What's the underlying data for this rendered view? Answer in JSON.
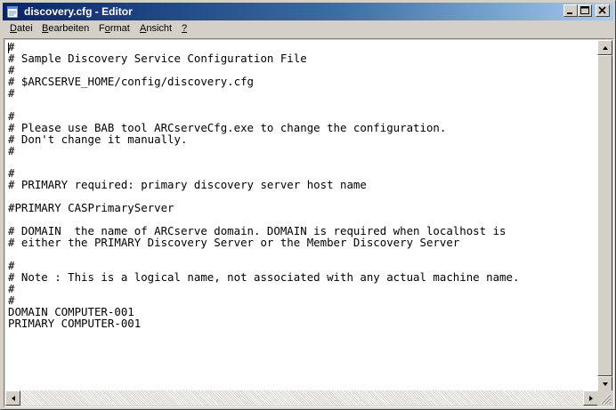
{
  "window": {
    "title": "discovery.cfg - Editor",
    "icon": "notepad-icon"
  },
  "titlebar_buttons": {
    "minimize_icon": "minimize-icon",
    "maximize_icon": "maximize-icon",
    "close_icon": "close-icon"
  },
  "menu": {
    "items": [
      {
        "label": "Datei",
        "mnemonic": "D"
      },
      {
        "label": "Bearbeiten",
        "mnemonic": "B"
      },
      {
        "label": "Format",
        "mnemonic": "o"
      },
      {
        "label": "Ansicht",
        "mnemonic": "A"
      },
      {
        "label": "?",
        "mnemonic": "?"
      }
    ]
  },
  "editor": {
    "lines": [
      "#",
      "# Sample Discovery Service Configuration File",
      "#",
      "# $ARCSERVE_HOME/config/discovery.cfg",
      "#",
      "",
      "#",
      "# Please use BAB tool ARCserveCfg.exe to change the configuration.",
      "# Don't change it manually.",
      "#",
      "",
      "#",
      "# PRIMARY required: primary discovery server host name",
      "",
      "#PRIMARY CASPrimaryServer",
      "",
      "# DOMAIN  the name of ARCserve domain. DOMAIN is required when localhost is",
      "# either the PRIMARY Discovery Server or the Member Discovery Server",
      "",
      "#",
      "# Note : This is a logical name, not associated with any actual machine name.",
      "#",
      "#",
      "DOMAIN COMPUTER-001",
      "PRIMARY COMPUTER-001"
    ]
  },
  "scrollbar": {
    "up_icon": "arrow-up-icon",
    "down_icon": "arrow-down-icon",
    "left_icon": "arrow-left-icon",
    "right_icon": "arrow-right-icon"
  }
}
